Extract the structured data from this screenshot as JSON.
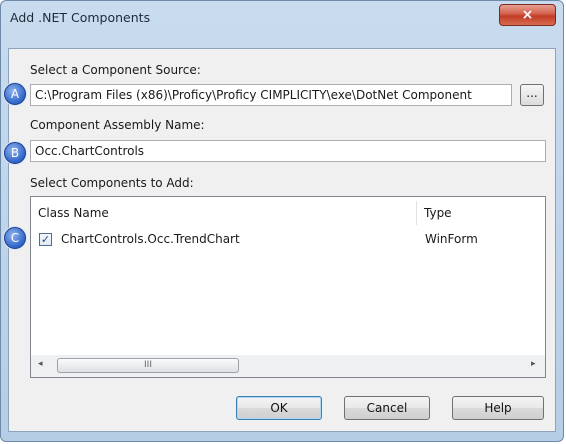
{
  "window": {
    "title": "Add .NET Components",
    "close_glyph": "×"
  },
  "source": {
    "label": "Select a Component Source:",
    "value": "C:\\Program Files (x86)\\Proficy\\Proficy CIMPLICITY\\exe\\DotNet Component",
    "browse_label": "..."
  },
  "assembly": {
    "label": "Component Assembly Name:",
    "value": "Occ.ChartControls"
  },
  "components": {
    "label": "Select Components to Add:",
    "columns": [
      "Class Name",
      "Type"
    ],
    "rows": [
      {
        "checked": true,
        "class_name": "ChartControls.Occ.TrendChart",
        "type": "WinForm"
      }
    ]
  },
  "scrollbar": {
    "left_arrow": "◂",
    "right_arrow": "▸",
    "thumb_grip": "III"
  },
  "markers": [
    "A",
    "B",
    "C"
  ],
  "buttons": {
    "ok": "OK",
    "cancel": "Cancel",
    "help": "Help"
  },
  "colors": {
    "title_bar": "#c9dcef",
    "close_button": "#c23c27",
    "marker": "#2e63c9"
  }
}
